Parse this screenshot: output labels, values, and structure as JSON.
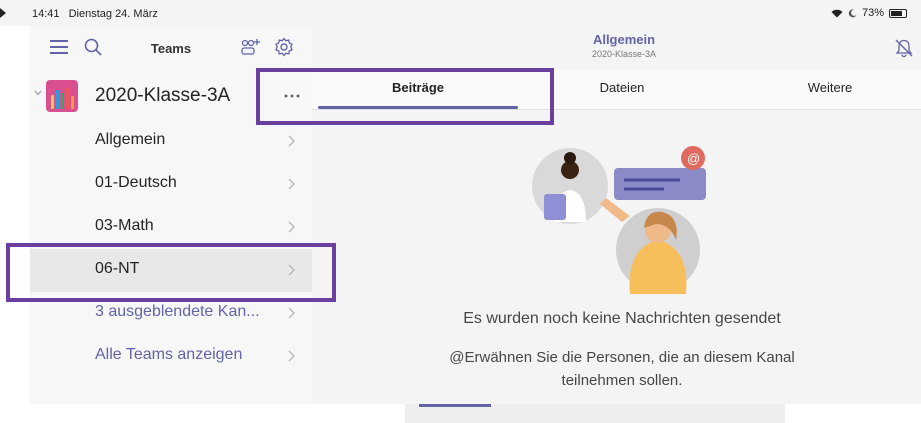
{
  "status_bar": {
    "time": "14:41",
    "date": "Dienstag 24. März",
    "battery": "73%"
  },
  "sidebar": {
    "title": "Teams",
    "team": {
      "name": "2020-Klasse-3A",
      "more": "···"
    },
    "channels": [
      {
        "label": "Allgemein"
      },
      {
        "label": "01-Deutsch"
      },
      {
        "label": "03-Math"
      },
      {
        "label": "06-NT"
      }
    ],
    "hidden_channels": "3 ausgeblendete Kan...",
    "all_teams": "Alle Teams anzeigen"
  },
  "channel_header": {
    "title": "Allgemein",
    "subtitle": "2020-Klasse-3A"
  },
  "tabs": [
    {
      "label": "Beiträge"
    },
    {
      "label": "Dateien"
    },
    {
      "label": "Weitere"
    }
  ],
  "empty_state": {
    "title": "Es wurden noch keine Nachrichten gesendet",
    "hint": "@Erwähnen Sie die Personen, die an diesem Kanal teilnehmen sollen.",
    "badge": "@"
  },
  "colors": {
    "accent": "#6264a7",
    "highlight": "#6b3fa0",
    "team_avatar": "#d94f8f"
  }
}
